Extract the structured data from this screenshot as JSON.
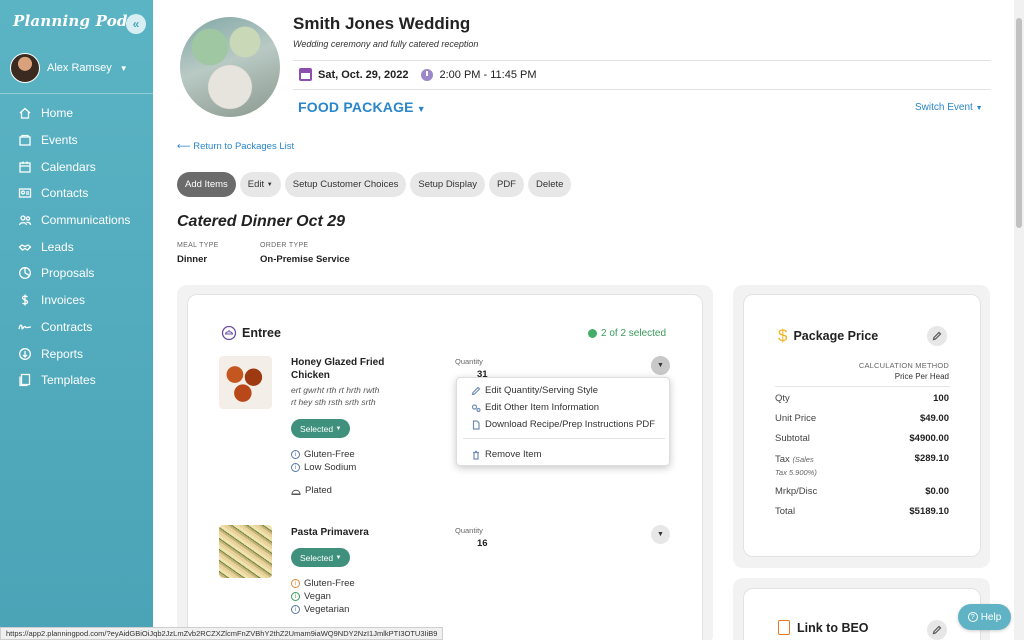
{
  "sidebar": {
    "brand": "Planning Pod",
    "collapse_icon": "«",
    "user_name": "Alex Ramsey",
    "items": [
      {
        "label": "Home",
        "icon": "home-icon"
      },
      {
        "label": "Events",
        "icon": "events-icon"
      },
      {
        "label": "Calendars",
        "icon": "calendar-icon"
      },
      {
        "label": "Contacts",
        "icon": "contacts-icon"
      },
      {
        "label": "Communications",
        "icon": "communications-icon"
      },
      {
        "label": "Leads",
        "icon": "leads-icon"
      },
      {
        "label": "Proposals",
        "icon": "proposals-icon"
      },
      {
        "label": "Invoices",
        "icon": "dollar-icon"
      },
      {
        "label": "Contracts",
        "icon": "signature-icon"
      },
      {
        "label": "Reports",
        "icon": "reports-icon"
      },
      {
        "label": "Templates",
        "icon": "templates-icon"
      }
    ]
  },
  "event": {
    "title": "Smith Jones Wedding",
    "subtitle": "Wedding ceremony and fully catered reception",
    "date": "Sat, Oct. 29, 2022",
    "time": "2:00 PM - 11:45 PM",
    "package_title": "FOOD PACKAGE",
    "switch_event": "Switch Event"
  },
  "return_link": "⟵ Return to Packages List",
  "toolbar": {
    "add_items": "Add Items",
    "edit": "Edit",
    "setup_choices": "Setup Customer Choices",
    "setup_display": "Setup Display",
    "pdf": "PDF",
    "delete": "Delete"
  },
  "menu": {
    "title": "Catered Dinner Oct 29",
    "meal_type_label": "MEAL TYPE",
    "meal_type": "Dinner",
    "order_type_label": "ORDER TYPE",
    "order_type": "On-Premise Service"
  },
  "entree": {
    "title": "Entree",
    "selected_count": "2 of 2 selected",
    "items": [
      {
        "name_line1": "Honey Glazed Fried",
        "name_line2": "Chicken",
        "desc_line1": "ert gwrht rth rt hrth rwth",
        "desc_line2": "rt hey sth rsth srth srth",
        "status": "Selected",
        "qty_label": "Quantity",
        "qty": "31",
        "tags": [
          "Gluten-Free",
          "Low Sodium"
        ],
        "style": "Plated"
      },
      {
        "name_line1": "Pasta Primavera",
        "status": "Selected",
        "qty_label": "Quantity",
        "qty": "16",
        "tags": [
          "Gluten-Free",
          "Vegan",
          "Vegetarian"
        ]
      }
    ]
  },
  "item_menu": {
    "edit_qty": "Edit Quantity/Serving Style",
    "edit_other": "Edit Other Item Information",
    "download": "Download Recipe/Prep Instructions PDF",
    "remove": "Remove Item"
  },
  "price": {
    "title": "Package Price",
    "calc_label": "CALCULATION METHOD",
    "calc_value": "Price Per Head",
    "rows": [
      {
        "label": "Qty",
        "value": "100"
      },
      {
        "label": "Unit Price",
        "value": "$49.00"
      },
      {
        "label": "Subtotal",
        "value": "$4900.00"
      },
      {
        "label": "Tax",
        "sub": "(Sales",
        "sub2": "Tax 5.900%)",
        "value": "$289.10"
      },
      {
        "label": "Mrkp/Disc",
        "value": "$0.00"
      },
      {
        "label": "Total",
        "value": "$5189.10"
      }
    ]
  },
  "beo": {
    "title": "Link to BEO"
  },
  "help": "Help",
  "status_url": "https://app2.planningpod.com/?eyAidGBiOiJqb2JzLmZvb2RCZXZlcmFnZVBhY2thZ2Umam9iaWQ9NDY2NzI1JmlkPTI3OTU3IiB9"
}
